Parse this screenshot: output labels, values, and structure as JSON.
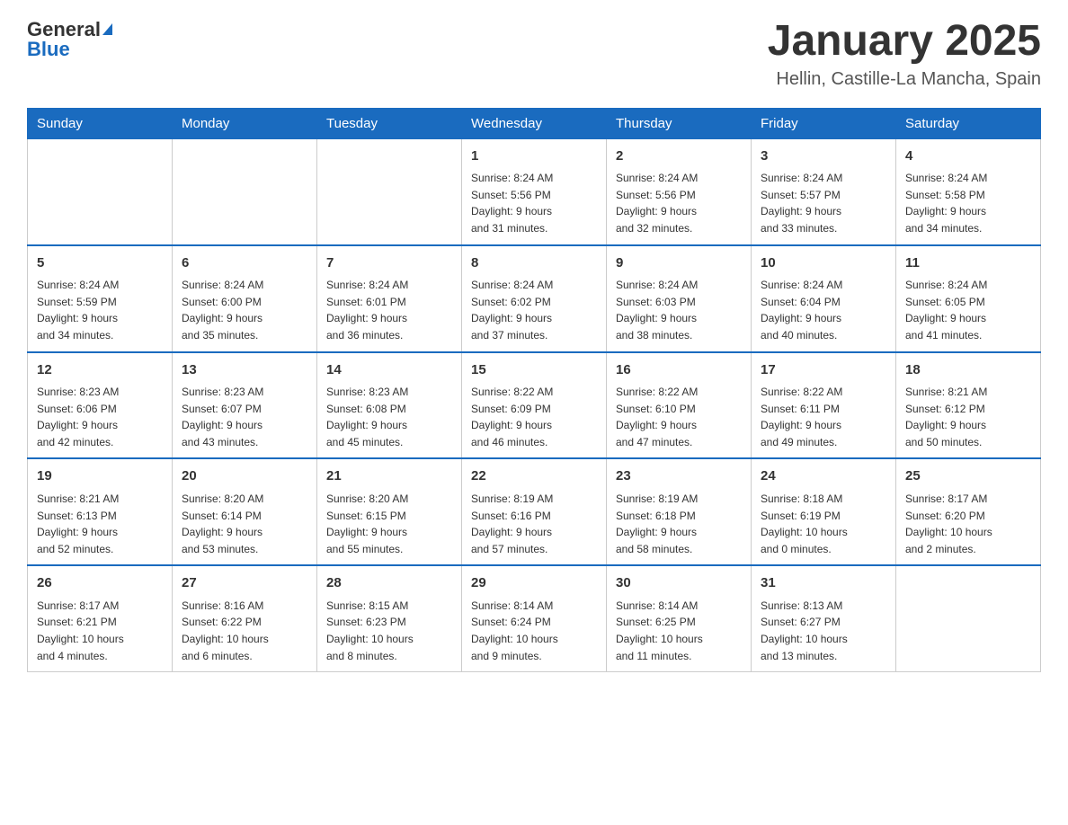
{
  "header": {
    "logo_text_general": "General",
    "logo_text_blue": "Blue",
    "title": "January 2025",
    "subtitle": "Hellin, Castille-La Mancha, Spain"
  },
  "weekdays": [
    "Sunday",
    "Monday",
    "Tuesday",
    "Wednesday",
    "Thursday",
    "Friday",
    "Saturday"
  ],
  "weeks": [
    [
      {
        "day": "",
        "info": ""
      },
      {
        "day": "",
        "info": ""
      },
      {
        "day": "",
        "info": ""
      },
      {
        "day": "1",
        "info": "Sunrise: 8:24 AM\nSunset: 5:56 PM\nDaylight: 9 hours\nand 31 minutes."
      },
      {
        "day": "2",
        "info": "Sunrise: 8:24 AM\nSunset: 5:56 PM\nDaylight: 9 hours\nand 32 minutes."
      },
      {
        "day": "3",
        "info": "Sunrise: 8:24 AM\nSunset: 5:57 PM\nDaylight: 9 hours\nand 33 minutes."
      },
      {
        "day": "4",
        "info": "Sunrise: 8:24 AM\nSunset: 5:58 PM\nDaylight: 9 hours\nand 34 minutes."
      }
    ],
    [
      {
        "day": "5",
        "info": "Sunrise: 8:24 AM\nSunset: 5:59 PM\nDaylight: 9 hours\nand 34 minutes."
      },
      {
        "day": "6",
        "info": "Sunrise: 8:24 AM\nSunset: 6:00 PM\nDaylight: 9 hours\nand 35 minutes."
      },
      {
        "day": "7",
        "info": "Sunrise: 8:24 AM\nSunset: 6:01 PM\nDaylight: 9 hours\nand 36 minutes."
      },
      {
        "day": "8",
        "info": "Sunrise: 8:24 AM\nSunset: 6:02 PM\nDaylight: 9 hours\nand 37 minutes."
      },
      {
        "day": "9",
        "info": "Sunrise: 8:24 AM\nSunset: 6:03 PM\nDaylight: 9 hours\nand 38 minutes."
      },
      {
        "day": "10",
        "info": "Sunrise: 8:24 AM\nSunset: 6:04 PM\nDaylight: 9 hours\nand 40 minutes."
      },
      {
        "day": "11",
        "info": "Sunrise: 8:24 AM\nSunset: 6:05 PM\nDaylight: 9 hours\nand 41 minutes."
      }
    ],
    [
      {
        "day": "12",
        "info": "Sunrise: 8:23 AM\nSunset: 6:06 PM\nDaylight: 9 hours\nand 42 minutes."
      },
      {
        "day": "13",
        "info": "Sunrise: 8:23 AM\nSunset: 6:07 PM\nDaylight: 9 hours\nand 43 minutes."
      },
      {
        "day": "14",
        "info": "Sunrise: 8:23 AM\nSunset: 6:08 PM\nDaylight: 9 hours\nand 45 minutes."
      },
      {
        "day": "15",
        "info": "Sunrise: 8:22 AM\nSunset: 6:09 PM\nDaylight: 9 hours\nand 46 minutes."
      },
      {
        "day": "16",
        "info": "Sunrise: 8:22 AM\nSunset: 6:10 PM\nDaylight: 9 hours\nand 47 minutes."
      },
      {
        "day": "17",
        "info": "Sunrise: 8:22 AM\nSunset: 6:11 PM\nDaylight: 9 hours\nand 49 minutes."
      },
      {
        "day": "18",
        "info": "Sunrise: 8:21 AM\nSunset: 6:12 PM\nDaylight: 9 hours\nand 50 minutes."
      }
    ],
    [
      {
        "day": "19",
        "info": "Sunrise: 8:21 AM\nSunset: 6:13 PM\nDaylight: 9 hours\nand 52 minutes."
      },
      {
        "day": "20",
        "info": "Sunrise: 8:20 AM\nSunset: 6:14 PM\nDaylight: 9 hours\nand 53 minutes."
      },
      {
        "day": "21",
        "info": "Sunrise: 8:20 AM\nSunset: 6:15 PM\nDaylight: 9 hours\nand 55 minutes."
      },
      {
        "day": "22",
        "info": "Sunrise: 8:19 AM\nSunset: 6:16 PM\nDaylight: 9 hours\nand 57 minutes."
      },
      {
        "day": "23",
        "info": "Sunrise: 8:19 AM\nSunset: 6:18 PM\nDaylight: 9 hours\nand 58 minutes."
      },
      {
        "day": "24",
        "info": "Sunrise: 8:18 AM\nSunset: 6:19 PM\nDaylight: 10 hours\nand 0 minutes."
      },
      {
        "day": "25",
        "info": "Sunrise: 8:17 AM\nSunset: 6:20 PM\nDaylight: 10 hours\nand 2 minutes."
      }
    ],
    [
      {
        "day": "26",
        "info": "Sunrise: 8:17 AM\nSunset: 6:21 PM\nDaylight: 10 hours\nand 4 minutes."
      },
      {
        "day": "27",
        "info": "Sunrise: 8:16 AM\nSunset: 6:22 PM\nDaylight: 10 hours\nand 6 minutes."
      },
      {
        "day": "28",
        "info": "Sunrise: 8:15 AM\nSunset: 6:23 PM\nDaylight: 10 hours\nand 8 minutes."
      },
      {
        "day": "29",
        "info": "Sunrise: 8:14 AM\nSunset: 6:24 PM\nDaylight: 10 hours\nand 9 minutes."
      },
      {
        "day": "30",
        "info": "Sunrise: 8:14 AM\nSunset: 6:25 PM\nDaylight: 10 hours\nand 11 minutes."
      },
      {
        "day": "31",
        "info": "Sunrise: 8:13 AM\nSunset: 6:27 PM\nDaylight: 10 hours\nand 13 minutes."
      },
      {
        "day": "",
        "info": ""
      }
    ]
  ]
}
